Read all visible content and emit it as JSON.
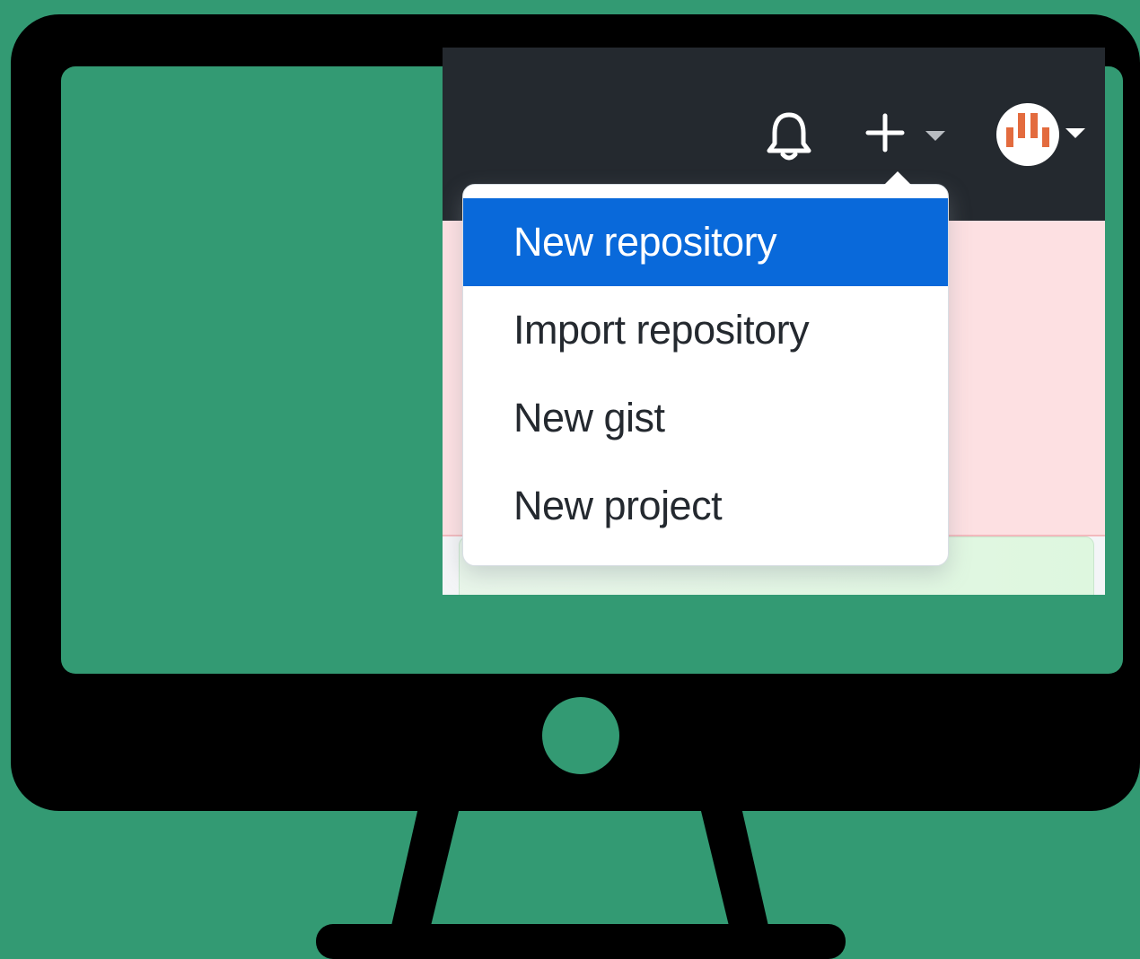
{
  "colors": {
    "background": "#339a73",
    "monitor": "#000000",
    "header_bg": "#24292f",
    "banner_bg": "#fde0e2",
    "menu_active_bg": "#0969da",
    "menu_text": "#24292f",
    "avatar_accent": "#e36b3e"
  },
  "header": {
    "icons": [
      "bell-icon",
      "plus-icon",
      "caret-down-icon",
      "avatar",
      "caret-down-icon"
    ]
  },
  "dropdown": {
    "items": [
      {
        "label": "New repository",
        "active": true
      },
      {
        "label": "Import repository",
        "active": false
      },
      {
        "label": "New gist",
        "active": false
      },
      {
        "label": "New project",
        "active": false
      }
    ]
  }
}
